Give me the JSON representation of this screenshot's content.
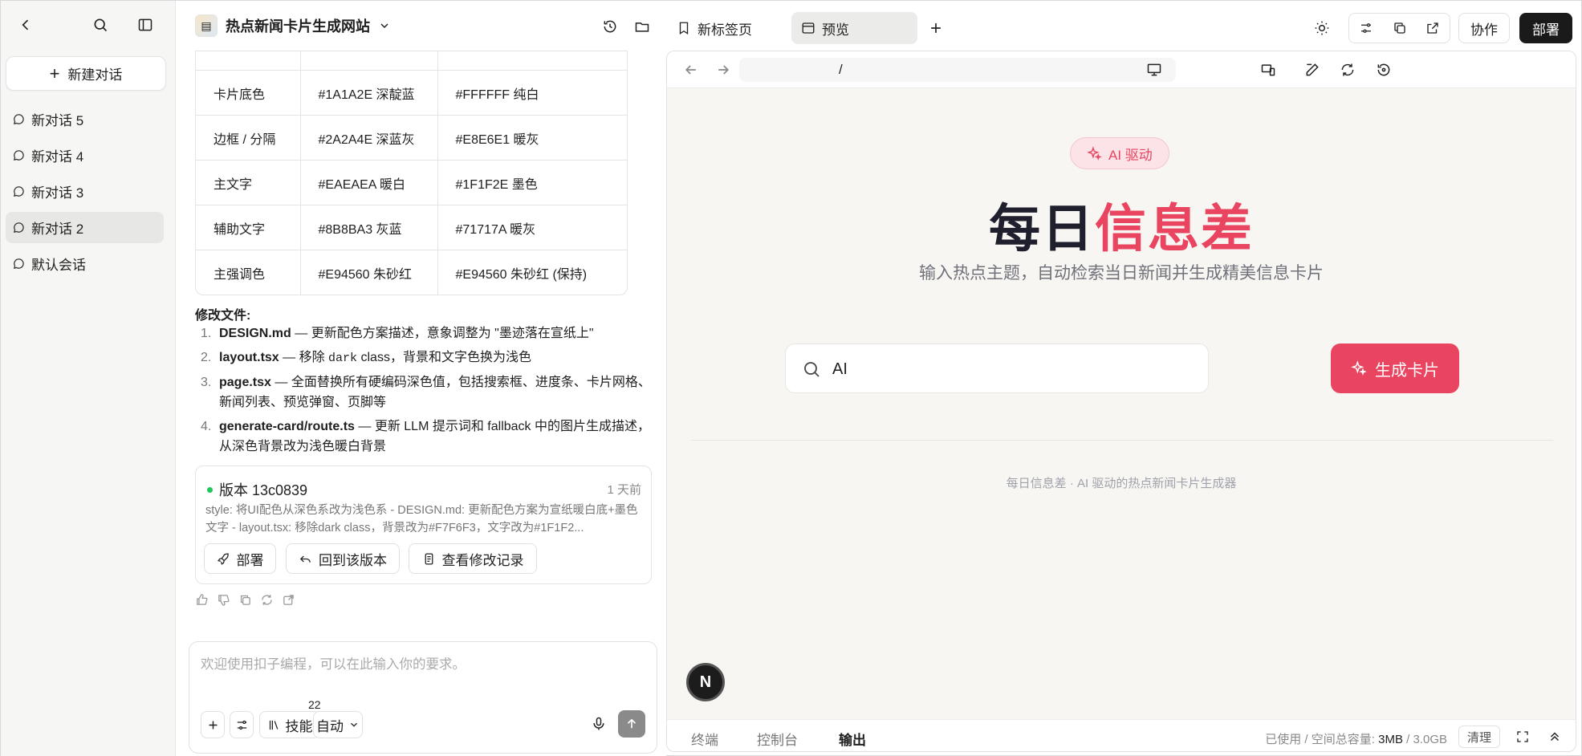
{
  "sidebar": {
    "new_chat": "新建对话",
    "conversations": [
      {
        "label": "新对话 5",
        "active": false
      },
      {
        "label": "新对话 4",
        "active": false
      },
      {
        "label": "新对话 3",
        "active": false
      },
      {
        "label": "新对话 2",
        "active": true
      },
      {
        "label": "默认会话",
        "active": false
      }
    ]
  },
  "header": {
    "project_name": "热点新闻卡片生成网站",
    "tabs": [
      {
        "label": "新标签页",
        "active": false
      },
      {
        "label": "预览",
        "active": true
      }
    ],
    "collab": "协作",
    "deploy": "部署"
  },
  "chat": {
    "color_table": [
      [
        "卡片底色",
        "#1A1A2E 深靛蓝",
        "#FFFFFF 纯白"
      ],
      [
        "边框 / 分隔",
        "#2A2A4E 深蓝灰",
        "#E8E6E1 暖灰"
      ],
      [
        "主文字",
        "#EAEAEA 暖白",
        "#1F1F2E 墨色"
      ],
      [
        "辅助文字",
        "#8B8BA3 灰蓝",
        "#71717A 暖灰"
      ],
      [
        "主强调色",
        "#E94560 朱砂红",
        "#E94560 朱砂红 (保持)"
      ]
    ],
    "files_title": "修改文件:",
    "files": [
      {
        "num": "1.",
        "name": "DESIGN.md",
        "desc": " — 更新配色方案描述，意象调整为 \"墨迹落在宣纸上\""
      },
      {
        "num": "2.",
        "name": "layout.tsx",
        "desc_pre": " — 移除 ",
        "code": "dark",
        "desc_post": " class，背景和文字色换为浅色"
      },
      {
        "num": "3.",
        "name": "page.tsx",
        "desc": " — 全面替换所有硬编码深色值，包括搜索框、进度条、卡片网格、新闻列表、预览弹窗、页脚等"
      },
      {
        "num": "4.",
        "name": "generate-card/route.ts",
        "desc": " — 更新 LLM 提示词和 fallback 中的图片生成描述，从深色背景改为浅色暖白背景"
      }
    ],
    "version": {
      "title": "版本 13c0839",
      "time": "1 天前",
      "desc": "style: 将UI配色从深色系改为浅色系 - DESIGN.md: 更新配色方案为宣纸暖白底+墨色文字 - layout.tsx: 移除dark class，背景改为#F7F6F3，文字改为#1F1F2...",
      "deploy": "部署",
      "revert": "回到该版本",
      "changes": "查看修改记录"
    },
    "composer": {
      "placeholder": "欢迎使用扣子编程，可以在此输入你的要求。",
      "skills": "技能",
      "skills_count": "22",
      "mode": "自动"
    }
  },
  "preview": {
    "address": "/",
    "pill": "AI 驱动",
    "headline_dark": "每日",
    "headline_red": "信息差",
    "subtitle": "输入热点主题，自动检索当日新闻并生成精美信息卡片",
    "search_value": "AI",
    "generate": "生成卡片",
    "footer_note": "每日信息差 · AI 驱动的热点新闻卡片生成器",
    "badge_letter": "N",
    "bottom_tabs": [
      {
        "label": "终端",
        "active": false
      },
      {
        "label": "控制台",
        "active": false
      },
      {
        "label": "输出",
        "active": true
      }
    ],
    "usage_prefix": "已使用 / 空间总容量:",
    "usage_used": "3MB",
    "usage_sep": " / ",
    "usage_total": "3.0GB",
    "clean": "清理"
  },
  "colors": {
    "accent": "#E94560",
    "ink": "#1F1F2E",
    "paper": "#F7F6F3"
  }
}
